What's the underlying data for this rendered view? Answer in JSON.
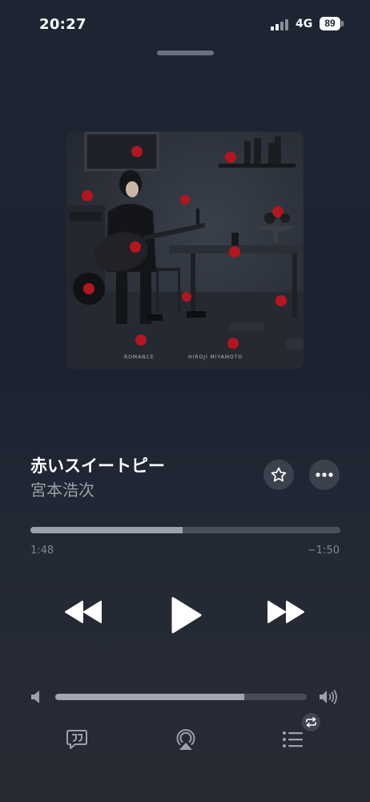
{
  "status_bar": {
    "time": "20:27",
    "network": "4G",
    "battery": "89"
  },
  "artwork": {
    "caption_left": "ROMANCE",
    "caption_right": "HIROJI MIYAMOTO"
  },
  "track": {
    "title": "赤いスイートピー",
    "artist": "宮本浩次"
  },
  "progress": {
    "elapsed": "1:48",
    "remaining": "−1:50",
    "fraction": 0.49
  },
  "volume": {
    "fraction": 0.75
  },
  "icons": {
    "favorite": "star-icon",
    "more": "ellipsis-icon",
    "previous": "rewind-icon",
    "play": "play-icon",
    "next": "fast-forward-icon",
    "volume_low": "speaker-icon",
    "volume_high": "speaker-wave-icon",
    "lyrics": "lyrics-quote-icon",
    "airplay": "airplay-icon",
    "queue": "list-icon",
    "repeat": "repeat-icon"
  },
  "colors": {
    "background": "#1e2533",
    "progress_fill": "#9ca1ab",
    "progress_track": "#4a505c",
    "accent_red": "#b3161e"
  }
}
